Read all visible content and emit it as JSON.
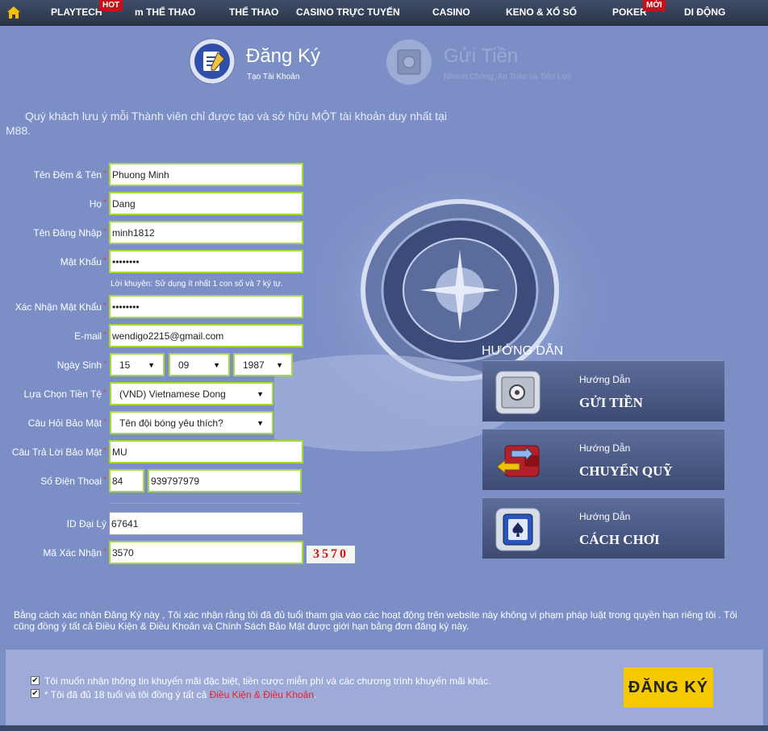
{
  "nav": {
    "items": [
      {
        "label": "PLAYTECH"
      },
      {
        "label": "m THỂ THAO"
      },
      {
        "label": "THỂ THAO"
      },
      {
        "label": "CASINO TRỰC TUYẾN"
      },
      {
        "label": "CASINO"
      },
      {
        "label": "KENO & XỔ SỐ"
      },
      {
        "label": "POKER"
      },
      {
        "label": "DI ĐỘNG"
      }
    ],
    "hot_badge": "HOT",
    "new_badge": "MỚI"
  },
  "steps": {
    "register": {
      "title": "Đăng Ký",
      "subtitle": "Tạo Tài Khoản"
    },
    "deposit": {
      "title": "Gửi Tiền",
      "subtitle": "Nhanh Chóng, An Toàn và Tiện Lợi!"
    }
  },
  "notice": "Quý khách lưu ý mỗi Thành viên chỉ được tạo và sở hữu MỘT tài khoản duy nhất tại M88.",
  "form": {
    "fullname": {
      "label": "Tên Đệm & Tên",
      "value": "Phuong Minh"
    },
    "lastname": {
      "label": "Họ",
      "value": "Dang"
    },
    "username": {
      "label": "Tên Đăng Nhập",
      "value": "minh1812"
    },
    "password": {
      "label": "Mật Khẩu",
      "value": "••••••••"
    },
    "password_hint": "Lời khuyên: Sử dụng ít nhất 1 con số và 7 ký tự.",
    "confirm_password": {
      "label": "Xác Nhận Mật Khẩu",
      "value": "••••••••"
    },
    "email": {
      "label": "E-mail",
      "value": "wendigo2215@gmail.com"
    },
    "birthdate": {
      "label": "Ngày Sinh",
      "day": "15",
      "month": "09",
      "year": "1987"
    },
    "currency": {
      "label": "Lựa Chọn Tiền Tệ",
      "value": "(VND) Vietnamese Dong"
    },
    "security_question": {
      "label": "Câu Hỏi Bảo Mật",
      "value": "Tên đội bóng yêu thích?"
    },
    "security_answer": {
      "label": "Câu Trả Lời Bảo Mật",
      "value": "MU"
    },
    "phone": {
      "label": "Số Điện Thoại",
      "code": "84",
      "number": "939797979"
    },
    "agent_id": {
      "label": "ID Đại Lý",
      "value": "67641"
    },
    "captcha": {
      "label": "Mã Xác Nhận",
      "value": "3570",
      "image_text": "3570"
    },
    "required_mark": "*"
  },
  "guides": {
    "heading": "HƯỚNG DẪN",
    "items": [
      {
        "small": "Hướng Dẫn",
        "title": "GỬI TIỀN"
      },
      {
        "small": "Hướng Dẫn",
        "title": "CHUYỂN QUỸ"
      },
      {
        "small": "Hướng Dẫn",
        "title": "CÁCH CHƠI"
      }
    ]
  },
  "terms_text": "Bằng cách xác nhận Đăng Ký này , Tôi xác nhận rằng tôi đã đủ tuổi tham gia vào các hoạt động trên website này không vi phạm pháp luật trong quyền hạn riêng tôi . Tôi cũng đồng ý tất cả Điều Kiện & Điều Khoản và Chính Sách Bảo Mật được giới hạn bằng đơn đăng ký này.",
  "checkboxes": {
    "promo": "Tôi muốn nhận thông tin khuyến mãi đặc biệt, tiền cược miễn phí và các chương trình khuyến mãi khác.",
    "age_prefix": "* Tôi đã đủ 18 tuổi và tôi đồng ý tất cả",
    "age_link": "Điều Kiện & Điều Khoản",
    "age_suffix": "."
  },
  "submit_label": "ĐĂNG KÝ",
  "colors": {
    "accent_border": "#a7d83c",
    "submit_bg": "#f5c800",
    "badge_red": "#c8101a",
    "link_red": "#e8202a"
  }
}
